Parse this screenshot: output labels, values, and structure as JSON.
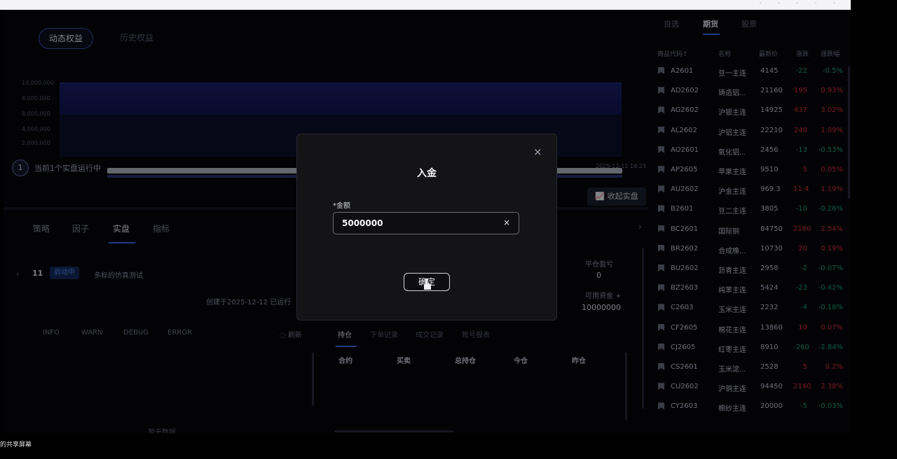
{
  "app": {
    "equity_tabs": [
      "动态权益",
      "历史权益"
    ],
    "chart_y_ticks": [
      "10,000,000",
      "8,000,000",
      "6,000,000",
      "4,000,000",
      "2,000,000"
    ],
    "running": {
      "count": "1",
      "text": "当前1个实盘运行中"
    },
    "slider_date": "2025-12-12 14:23",
    "collapse_button": "收起实盘",
    "sub_tabs": [
      "策略",
      "因子",
      "实盘",
      "指标"
    ],
    "run": {
      "id": "11",
      "status": "启动中",
      "name": "多标的仿真测试",
      "created": "创建于2025-12-12   已运行"
    },
    "log_levels": [
      "INFO",
      "WARN",
      "DEBUG",
      "ERROR"
    ],
    "refresh": "◌ 刷新",
    "no_data": "暂无数据",
    "position_tabs": [
      "持仓",
      "下单记录",
      "成交记录",
      "账号报表"
    ],
    "position_headers": [
      "合约",
      "买卖",
      "总持仓",
      "今仓",
      "昨仓"
    ],
    "close_pnl": {
      "label": "平仓盈亏",
      "value": "0"
    },
    "available_cash": {
      "label": "可用资金 +",
      "value": "10000000"
    }
  },
  "watchlist": {
    "tabs": [
      "自选",
      "期货",
      "股票"
    ],
    "headers": [
      "商品代码↑",
      "名称",
      "最新价",
      "涨跌",
      "涨跌幅"
    ],
    "rows": [
      {
        "code": "A2601",
        "name": "豆一主连",
        "price": "4145",
        "chg": "-22",
        "pct": "-0.5%",
        "dir": "down"
      },
      {
        "code": "AD2602",
        "name": "铸造铝...",
        "price": "21160",
        "chg": "195",
        "pct": "0.93%",
        "dir": "up"
      },
      {
        "code": "AG2602",
        "name": "沪银主连",
        "price": "14925",
        "chg": "437",
        "pct": "3.02%",
        "dir": "up"
      },
      {
        "code": "AL2602",
        "name": "沪铝主连",
        "price": "22210",
        "chg": "240",
        "pct": "1.09%",
        "dir": "up"
      },
      {
        "code": "AO2601",
        "name": "氧化铝...",
        "price": "2456",
        "chg": "-13",
        "pct": "-0.53%",
        "dir": "down"
      },
      {
        "code": "AP2605",
        "name": "苹果主连",
        "price": "9510",
        "chg": "5",
        "pct": "0.05%",
        "dir": "up"
      },
      {
        "code": "AU2602",
        "name": "沪金主连",
        "price": "969.3",
        "chg": "11.4",
        "pct": "1.19%",
        "dir": "up"
      },
      {
        "code": "B2601",
        "name": "豆二主连",
        "price": "3805",
        "chg": "-10",
        "pct": "-0.26%",
        "dir": "down"
      },
      {
        "code": "BC2601",
        "name": "国际铜",
        "price": "84750",
        "chg": "2100",
        "pct": "2.54%",
        "dir": "up"
      },
      {
        "code": "BR2602",
        "name": "合成橡...",
        "price": "10730",
        "chg": "20",
        "pct": "0.19%",
        "dir": "up"
      },
      {
        "code": "BU2602",
        "name": "沥青主连",
        "price": "2958",
        "chg": "-2",
        "pct": "-0.07%",
        "dir": "down"
      },
      {
        "code": "BZ2603",
        "name": "纯苯主连",
        "price": "5424",
        "chg": "-23",
        "pct": "-0.42%",
        "dir": "down"
      },
      {
        "code": "C2603",
        "name": "玉米主连",
        "price": "2232",
        "chg": "-4",
        "pct": "-0.18%",
        "dir": "down"
      },
      {
        "code": "CF2605",
        "name": "棉花主连",
        "price": "13860",
        "chg": "10",
        "pct": "0.07%",
        "dir": "up"
      },
      {
        "code": "CJ2605",
        "name": "红枣主连",
        "price": "8910",
        "chg": "-260",
        "pct": "-2.84%",
        "dir": "down"
      },
      {
        "code": "CS2601",
        "name": "玉米淀...",
        "price": "2528",
        "chg": "5",
        "pct": "0.2%",
        "dir": "up"
      },
      {
        "code": "CU2602",
        "name": "沪铜主连",
        "price": "94450",
        "chg": "2140",
        "pct": "2.38%",
        "dir": "up"
      },
      {
        "code": "CY2603",
        "name": "棉纱主连",
        "price": "20000",
        "chg": "-5",
        "pct": "-0.03%",
        "dir": "down"
      }
    ],
    "colors": {
      "up": "#e0323c",
      "down": "#1fa97a"
    }
  },
  "dialog": {
    "close": "×",
    "title": "入金",
    "amount_label": "*金额",
    "amount_value": "5000000",
    "clear": "×",
    "confirm": "确定"
  },
  "share_label": "的共享屏幕"
}
